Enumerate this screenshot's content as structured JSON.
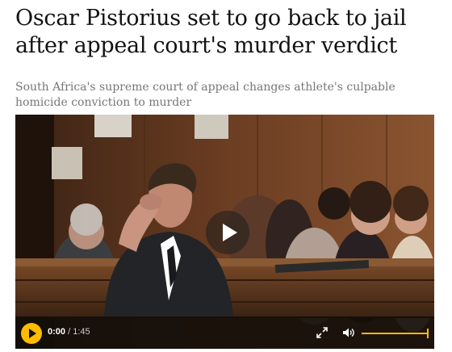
{
  "article": {
    "headline": "Oscar Pistorius set to go back to jail after appeal court's murder verdict",
    "standfirst": "South Africa's supreme court of appeal changes athlete's culpable homicide conviction to murder"
  },
  "video": {
    "current_time": "0:00",
    "separator": "/",
    "duration": "1:45",
    "volume_level": 1.0,
    "accent_color": "#ffbb00",
    "play_icon": "play-icon",
    "fullscreen_icon": "fullscreen-icon",
    "volume_icon": "volume-icon"
  }
}
